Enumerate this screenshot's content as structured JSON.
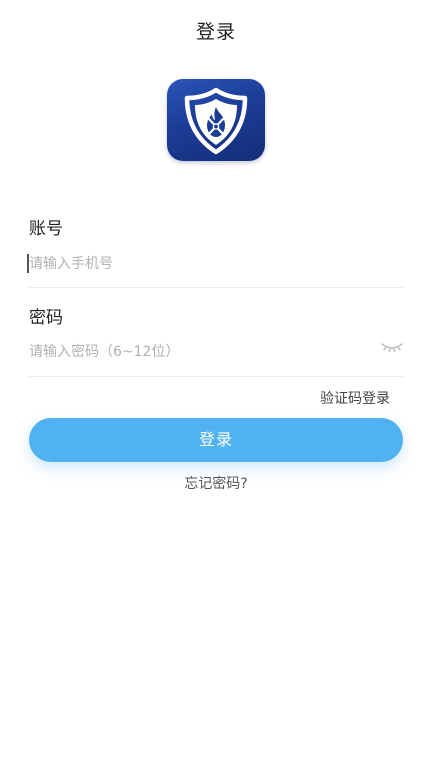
{
  "header": {
    "title": "登录"
  },
  "logo": {
    "icon": "fire-shield-icon",
    "colors": {
      "background": "#1c3d96",
      "shield": "#ffffff",
      "flame": "#1c3d96"
    }
  },
  "account": {
    "label": "账号",
    "placeholder": "请输入手机号",
    "value": ""
  },
  "password": {
    "label": "密码",
    "placeholder": "请输入密码（6~12位）",
    "value": "",
    "toggle_icon": "eye-closed-icon"
  },
  "actions": {
    "sms_login_label": "验证码登录",
    "login_label": "登录",
    "forgot_password_label": "忘记密码?"
  },
  "colors": {
    "accent": "#51b2f1",
    "divider": "#ececec",
    "placeholder": "#b0b0b0"
  }
}
